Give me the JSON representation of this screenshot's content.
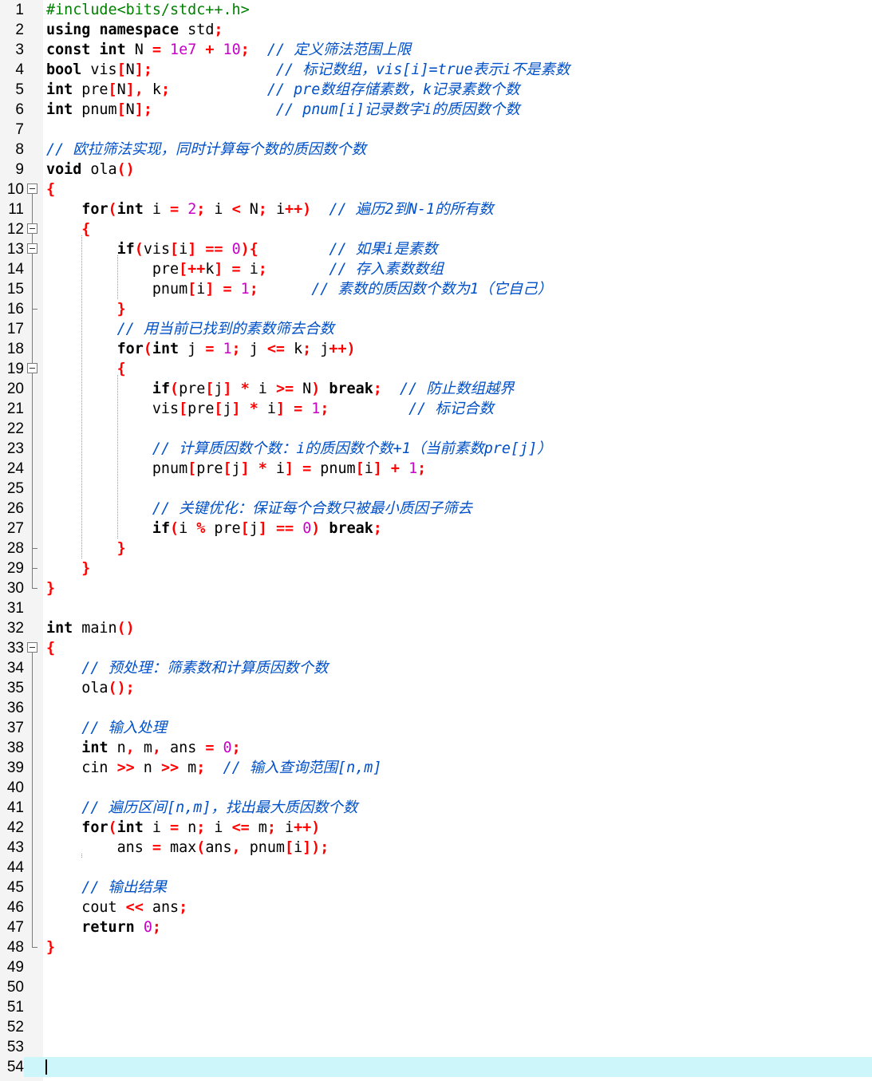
{
  "editor": {
    "current_line": 54,
    "lines": [
      [
        [
          "pp",
          "#include<bits/stdc++.h>"
        ]
      ],
      [
        [
          "kw",
          "using"
        ],
        [
          "t",
          " "
        ],
        [
          "kw",
          "namespace"
        ],
        [
          "t",
          " std"
        ],
        [
          "op",
          ";"
        ]
      ],
      [
        [
          "kw",
          "const"
        ],
        [
          "t",
          " "
        ],
        [
          "kw",
          "int"
        ],
        [
          "t",
          " N "
        ],
        [
          "op",
          "="
        ],
        [
          "t",
          " "
        ],
        [
          "num",
          "1e7"
        ],
        [
          "t",
          " "
        ],
        [
          "op",
          "+"
        ],
        [
          "t",
          " "
        ],
        [
          "num",
          "10"
        ],
        [
          "op",
          ";"
        ],
        [
          "t",
          "  "
        ],
        [
          "cm",
          "// 定义筛法范围上限"
        ]
      ],
      [
        [
          "kw",
          "bool"
        ],
        [
          "t",
          " vis"
        ],
        [
          "op",
          "["
        ],
        [
          "t",
          "N"
        ],
        [
          "op",
          "];"
        ],
        [
          "t",
          "              "
        ],
        [
          "cm",
          "// 标记数组，vis[i]=true表示i不是素数"
        ]
      ],
      [
        [
          "kw",
          "int"
        ],
        [
          "t",
          " pre"
        ],
        [
          "op",
          "["
        ],
        [
          "t",
          "N"
        ],
        [
          "op",
          "],"
        ],
        [
          "t",
          " k"
        ],
        [
          "op",
          ";"
        ],
        [
          "t",
          "           "
        ],
        [
          "cm",
          "// pre数组存储素数，k记录素数个数"
        ]
      ],
      [
        [
          "kw",
          "int"
        ],
        [
          "t",
          " pnum"
        ],
        [
          "op",
          "["
        ],
        [
          "t",
          "N"
        ],
        [
          "op",
          "];"
        ],
        [
          "t",
          "              "
        ],
        [
          "cm",
          "// pnum[i]记录数字i的质因数个数"
        ]
      ],
      [],
      [
        [
          "cm",
          "// 欧拉筛法实现，同时计算每个数的质因数个数"
        ]
      ],
      [
        [
          "kw",
          "void"
        ],
        [
          "t",
          " ola"
        ],
        [
          "op",
          "()"
        ]
      ],
      [
        [
          "op",
          "{"
        ]
      ],
      [
        [
          "t",
          "    "
        ],
        [
          "kw",
          "for"
        ],
        [
          "op",
          "("
        ],
        [
          "kw",
          "int"
        ],
        [
          "t",
          " i "
        ],
        [
          "op",
          "="
        ],
        [
          "t",
          " "
        ],
        [
          "num",
          "2"
        ],
        [
          "op",
          ";"
        ],
        [
          "t",
          " i "
        ],
        [
          "op",
          "<"
        ],
        [
          "t",
          " N"
        ],
        [
          "op",
          ";"
        ],
        [
          "t",
          " i"
        ],
        [
          "op",
          "++)"
        ],
        [
          "t",
          "  "
        ],
        [
          "cm",
          "// 遍历2到N-1的所有数"
        ]
      ],
      [
        [
          "t",
          "    "
        ],
        [
          "op",
          "{"
        ]
      ],
      [
        [
          "t",
          "        "
        ],
        [
          "kw",
          "if"
        ],
        [
          "op",
          "("
        ],
        [
          "t",
          "vis"
        ],
        [
          "op",
          "["
        ],
        [
          "t",
          "i"
        ],
        [
          "op",
          "]"
        ],
        [
          "t",
          " "
        ],
        [
          "op",
          "=="
        ],
        [
          "t",
          " "
        ],
        [
          "num",
          "0"
        ],
        [
          "op",
          "){"
        ],
        [
          "t",
          "        "
        ],
        [
          "cm",
          "// 如果i是素数"
        ]
      ],
      [
        [
          "t",
          "            pre"
        ],
        [
          "op",
          "[++"
        ],
        [
          "t",
          "k"
        ],
        [
          "op",
          "]"
        ],
        [
          "t",
          " "
        ],
        [
          "op",
          "="
        ],
        [
          "t",
          " i"
        ],
        [
          "op",
          ";"
        ],
        [
          "t",
          "       "
        ],
        [
          "cm",
          "// 存入素数数组"
        ]
      ],
      [
        [
          "t",
          "            pnum"
        ],
        [
          "op",
          "["
        ],
        [
          "t",
          "i"
        ],
        [
          "op",
          "]"
        ],
        [
          "t",
          " "
        ],
        [
          "op",
          "="
        ],
        [
          "t",
          " "
        ],
        [
          "num",
          "1"
        ],
        [
          "op",
          ";"
        ],
        [
          "t",
          "      "
        ],
        [
          "cm",
          "// 素数的质因数个数为1（它自己）"
        ]
      ],
      [
        [
          "t",
          "        "
        ],
        [
          "op",
          "}"
        ]
      ],
      [
        [
          "t",
          "        "
        ],
        [
          "cm",
          "// 用当前已找到的素数筛去合数"
        ]
      ],
      [
        [
          "t",
          "        "
        ],
        [
          "kw",
          "for"
        ],
        [
          "op",
          "("
        ],
        [
          "kw",
          "int"
        ],
        [
          "t",
          " j "
        ],
        [
          "op",
          "="
        ],
        [
          "t",
          " "
        ],
        [
          "num",
          "1"
        ],
        [
          "op",
          ";"
        ],
        [
          "t",
          " j "
        ],
        [
          "op",
          "<="
        ],
        [
          "t",
          " k"
        ],
        [
          "op",
          ";"
        ],
        [
          "t",
          " j"
        ],
        [
          "op",
          "++)"
        ]
      ],
      [
        [
          "t",
          "        "
        ],
        [
          "op",
          "{"
        ]
      ],
      [
        [
          "t",
          "            "
        ],
        [
          "kw",
          "if"
        ],
        [
          "op",
          "("
        ],
        [
          "t",
          "pre"
        ],
        [
          "op",
          "["
        ],
        [
          "t",
          "j"
        ],
        [
          "op",
          "]"
        ],
        [
          "t",
          " "
        ],
        [
          "op",
          "*"
        ],
        [
          "t",
          " i "
        ],
        [
          "op",
          ">="
        ],
        [
          "t",
          " N"
        ],
        [
          "op",
          ")"
        ],
        [
          "t",
          " "
        ],
        [
          "kw",
          "break"
        ],
        [
          "op",
          ";"
        ],
        [
          "t",
          "  "
        ],
        [
          "cm",
          "// 防止数组越界"
        ]
      ],
      [
        [
          "t",
          "            vis"
        ],
        [
          "op",
          "["
        ],
        [
          "t",
          "pre"
        ],
        [
          "op",
          "["
        ],
        [
          "t",
          "j"
        ],
        [
          "op",
          "]"
        ],
        [
          "t",
          " "
        ],
        [
          "op",
          "*"
        ],
        [
          "t",
          " i"
        ],
        [
          "op",
          "]"
        ],
        [
          "t",
          " "
        ],
        [
          "op",
          "="
        ],
        [
          "t",
          " "
        ],
        [
          "num",
          "1"
        ],
        [
          "op",
          ";"
        ],
        [
          "t",
          "         "
        ],
        [
          "cm",
          "// 标记合数"
        ]
      ],
      [],
      [
        [
          "t",
          "            "
        ],
        [
          "cm",
          "// 计算质因数个数：i的质因数个数+1（当前素数pre[j]）"
        ]
      ],
      [
        [
          "t",
          "            pnum"
        ],
        [
          "op",
          "["
        ],
        [
          "t",
          "pre"
        ],
        [
          "op",
          "["
        ],
        [
          "t",
          "j"
        ],
        [
          "op",
          "]"
        ],
        [
          "t",
          " "
        ],
        [
          "op",
          "*"
        ],
        [
          "t",
          " i"
        ],
        [
          "op",
          "]"
        ],
        [
          "t",
          " "
        ],
        [
          "op",
          "="
        ],
        [
          "t",
          " pnum"
        ],
        [
          "op",
          "["
        ],
        [
          "t",
          "i"
        ],
        [
          "op",
          "]"
        ],
        [
          "t",
          " "
        ],
        [
          "op",
          "+"
        ],
        [
          "t",
          " "
        ],
        [
          "num",
          "1"
        ],
        [
          "op",
          ";"
        ]
      ],
      [],
      [
        [
          "t",
          "            "
        ],
        [
          "cm",
          "// 关键优化：保证每个合数只被最小质因子筛去"
        ]
      ],
      [
        [
          "t",
          "            "
        ],
        [
          "kw",
          "if"
        ],
        [
          "op",
          "("
        ],
        [
          "t",
          "i "
        ],
        [
          "op",
          "%"
        ],
        [
          "t",
          " pre"
        ],
        [
          "op",
          "["
        ],
        [
          "t",
          "j"
        ],
        [
          "op",
          "]"
        ],
        [
          "t",
          " "
        ],
        [
          "op",
          "=="
        ],
        [
          "t",
          " "
        ],
        [
          "num",
          "0"
        ],
        [
          "op",
          ")"
        ],
        [
          "t",
          " "
        ],
        [
          "kw",
          "break"
        ],
        [
          "op",
          ";"
        ]
      ],
      [
        [
          "t",
          "        "
        ],
        [
          "op",
          "}"
        ]
      ],
      [
        [
          "t",
          "    "
        ],
        [
          "op",
          "}"
        ]
      ],
      [
        [
          "op",
          "}"
        ]
      ],
      [],
      [
        [
          "kw",
          "int"
        ],
        [
          "t",
          " main"
        ],
        [
          "op",
          "()"
        ]
      ],
      [
        [
          "op",
          "{"
        ]
      ],
      [
        [
          "t",
          "    "
        ],
        [
          "cm",
          "// 预处理：筛素数和计算质因数个数"
        ]
      ],
      [
        [
          "t",
          "    ola"
        ],
        [
          "op",
          "();"
        ]
      ],
      [],
      [
        [
          "t",
          "    "
        ],
        [
          "cm",
          "// 输入处理"
        ]
      ],
      [
        [
          "t",
          "    "
        ],
        [
          "kw",
          "int"
        ],
        [
          "t",
          " n"
        ],
        [
          "op",
          ","
        ],
        [
          "t",
          " m"
        ],
        [
          "op",
          ","
        ],
        [
          "t",
          " ans "
        ],
        [
          "op",
          "="
        ],
        [
          "t",
          " "
        ],
        [
          "num",
          "0"
        ],
        [
          "op",
          ";"
        ]
      ],
      [
        [
          "t",
          "    cin "
        ],
        [
          "op",
          ">>"
        ],
        [
          "t",
          " n "
        ],
        [
          "op",
          ">>"
        ],
        [
          "t",
          " m"
        ],
        [
          "op",
          ";"
        ],
        [
          "t",
          "  "
        ],
        [
          "cm",
          "// 输入查询范围[n,m]"
        ]
      ],
      [],
      [
        [
          "t",
          "    "
        ],
        [
          "cm",
          "// 遍历区间[n,m]，找出最大质因数个数"
        ]
      ],
      [
        [
          "t",
          "    "
        ],
        [
          "kw",
          "for"
        ],
        [
          "op",
          "("
        ],
        [
          "kw",
          "int"
        ],
        [
          "t",
          " i "
        ],
        [
          "op",
          "="
        ],
        [
          "t",
          " n"
        ],
        [
          "op",
          ";"
        ],
        [
          "t",
          " i "
        ],
        [
          "op",
          "<="
        ],
        [
          "t",
          " m"
        ],
        [
          "op",
          ";"
        ],
        [
          "t",
          " i"
        ],
        [
          "op",
          "++)"
        ]
      ],
      [
        [
          "t",
          "        ans "
        ],
        [
          "op",
          "="
        ],
        [
          "t",
          " max"
        ],
        [
          "op",
          "("
        ],
        [
          "t",
          "ans"
        ],
        [
          "op",
          ","
        ],
        [
          "t",
          " pnum"
        ],
        [
          "op",
          "["
        ],
        [
          "t",
          "i"
        ],
        [
          "op",
          "]);"
        ]
      ],
      [],
      [
        [
          "t",
          "    "
        ],
        [
          "cm",
          "// 输出结果"
        ]
      ],
      [
        [
          "t",
          "    cout "
        ],
        [
          "op",
          "<<"
        ],
        [
          "t",
          " ans"
        ],
        [
          "op",
          ";"
        ]
      ],
      [
        [
          "t",
          "    "
        ],
        [
          "kw",
          "return"
        ],
        [
          "t",
          " "
        ],
        [
          "num",
          "0"
        ],
        [
          "op",
          ";"
        ]
      ],
      [
        [
          "op",
          "}"
        ]
      ],
      [],
      [],
      [],
      [],
      [],
      []
    ]
  }
}
